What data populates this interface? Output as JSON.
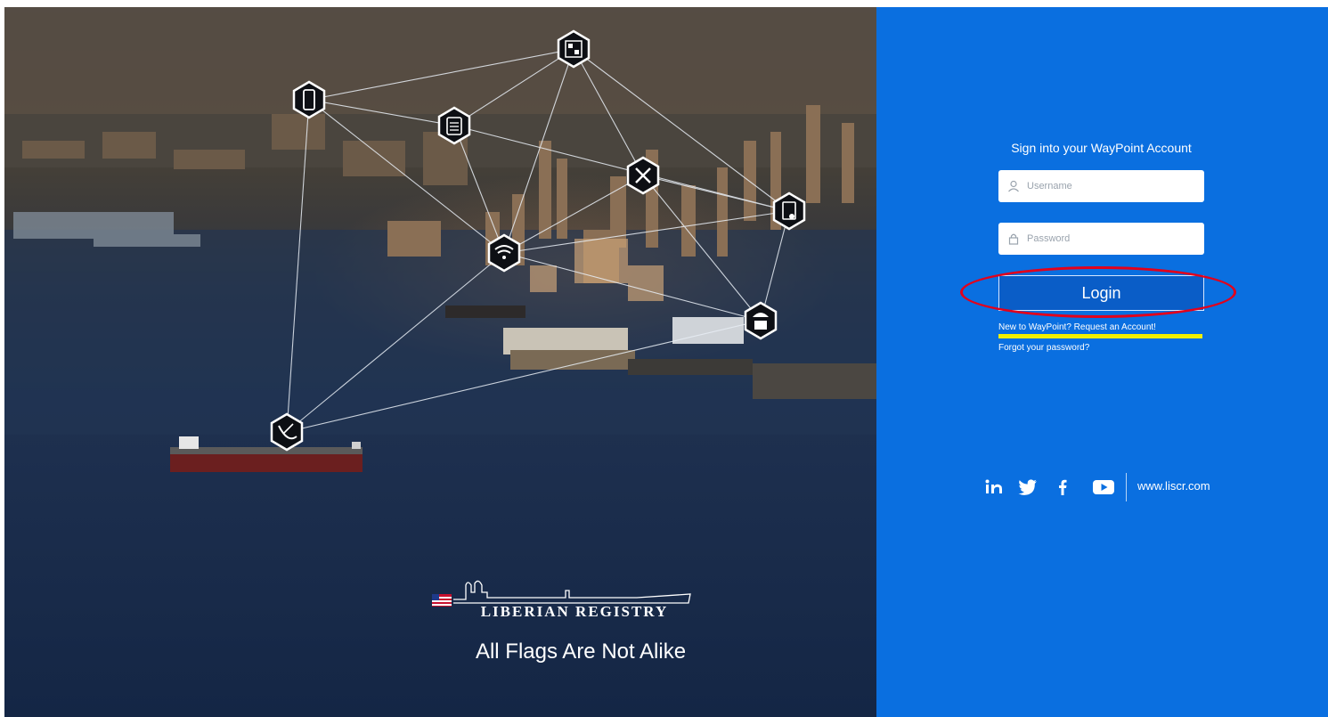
{
  "hero": {
    "brand_name": "LIBERIAN REGISTRY",
    "tagline": "All Flags Are Not Alike",
    "network_icons": [
      "qr-code-icon",
      "mobile-phone-icon",
      "clipboard-list-icon",
      "tools-icon",
      "certificate-icon",
      "wifi-icon",
      "engineer-helmet-icon",
      "satellite-dish-icon"
    ]
  },
  "signin": {
    "title": "Sign into your WayPoint Account",
    "username_placeholder": "Username",
    "password_placeholder": "Password",
    "login_label": "Login",
    "request_account_link": "New to WayPoint? Request an Account!",
    "forgot_password_link": "Forgot your password?"
  },
  "social": {
    "items": [
      "linkedin-icon",
      "twitter-icon",
      "facebook-icon",
      "youtube-icon"
    ],
    "website": "www.liscr.com"
  },
  "colors": {
    "panel_blue": "#0a6fe0",
    "highlight_red": "#e3001b",
    "highlight_yellow": "#f2f000"
  }
}
